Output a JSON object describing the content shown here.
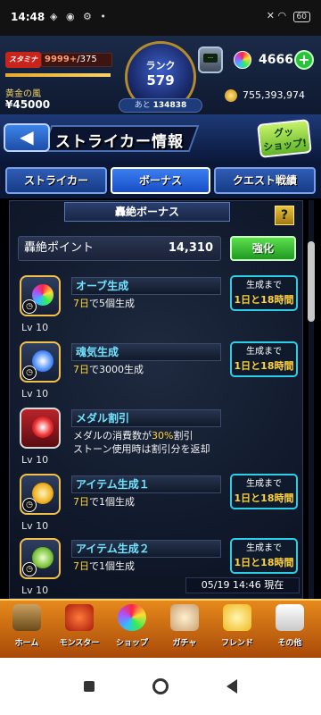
{
  "status_bar": {
    "time": "14:48",
    "left_icons": "◈ ◉ ⚙ •",
    "right_icons": "✕ ◠",
    "battery": "60"
  },
  "top": {
    "stamina_label": "スタミナ",
    "stamina_current": "9999+",
    "stamina_max": "/375",
    "gold_label": "黄金の風",
    "money": "¥45000",
    "rank_label": "ランク",
    "rank": "579",
    "rank_next_prefix": "あと",
    "rank_next_value": "134838",
    "machine_screen": "---",
    "orbs": "4666",
    "add_orb": "+",
    "coins": "755,393,974"
  },
  "header": {
    "back": "◀",
    "title": "ストライカー情報",
    "guide_label": "グッ\nショップ!"
  },
  "tabs": [
    {
      "label": "ストライカー",
      "active": false
    },
    {
      "label": "ボーナス",
      "active": true
    },
    {
      "label": "クエスト戦績",
      "active": false
    }
  ],
  "section": {
    "title": "轟絶ボーナス",
    "help": "?"
  },
  "points": {
    "label": "轟絶ポイント",
    "value": "14,310",
    "button": "強化"
  },
  "bonuses": [
    {
      "name": "オーブ生成",
      "level": "Lv 10",
      "desc1_hl": "7日",
      "desc1_rest": "で5個生成",
      "desc2": "",
      "status_label": "生成まで",
      "status_value": "1日と18時間",
      "icon": "orb-icon",
      "icon_color": "#e8f",
      "red": false
    },
    {
      "name": "魂気生成",
      "level": "Lv 10",
      "desc1_hl": "7日",
      "desc1_rest": "で3000生成",
      "desc2": "",
      "status_label": "生成まで",
      "status_value": "1日と18時間",
      "icon": "spirit-flame-icon",
      "icon_color": "#6af",
      "red": false
    },
    {
      "name": "メダル割引",
      "level": "Lv 10",
      "desc1_hl": "",
      "desc1_rest": "メダルの消費数が",
      "desc1_pct": "30%",
      "desc1_tail": "割引",
      "desc2": "ストーン使用時は割引分を返却",
      "status_label": "",
      "status_value": "",
      "icon": "medal-icon",
      "icon_color": "#e33",
      "red": true
    },
    {
      "name": "アイテム生成１",
      "level": "Lv 10",
      "desc1_hl": "7日",
      "desc1_rest": "で1個生成",
      "desc2": "",
      "status_label": "生成まで",
      "status_value": "1日と18時間",
      "icon": "bell-icon",
      "icon_color": "#fc4",
      "red": false
    },
    {
      "name": "アイテム生成２",
      "level": "Lv 10",
      "desc1_hl": "7日",
      "desc1_rest": "で1個生成",
      "desc2": "",
      "status_label": "生成まで",
      "status_value": "1日と18時間",
      "icon": "bottle-icon",
      "icon_color": "#8e4",
      "red": false
    }
  ],
  "timestamp": "05/19 14:46 現在",
  "nav": [
    {
      "label": "ホーム",
      "icon": "home-icon",
      "color": "#7a5a2a"
    },
    {
      "label": "モンスター",
      "icon": "monster-icon",
      "color": "#c83a1a"
    },
    {
      "label": "ショップ",
      "icon": "shop-orb-icon",
      "color": "#b04ae0"
    },
    {
      "label": "ガチャ",
      "icon": "gacha-icon",
      "color": "#e8d0a0"
    },
    {
      "label": "フレンド",
      "icon": "friend-icon",
      "color": "#ffcf3a"
    },
    {
      "label": "その他",
      "icon": "other-icon",
      "color": "#e8e8e8"
    }
  ]
}
